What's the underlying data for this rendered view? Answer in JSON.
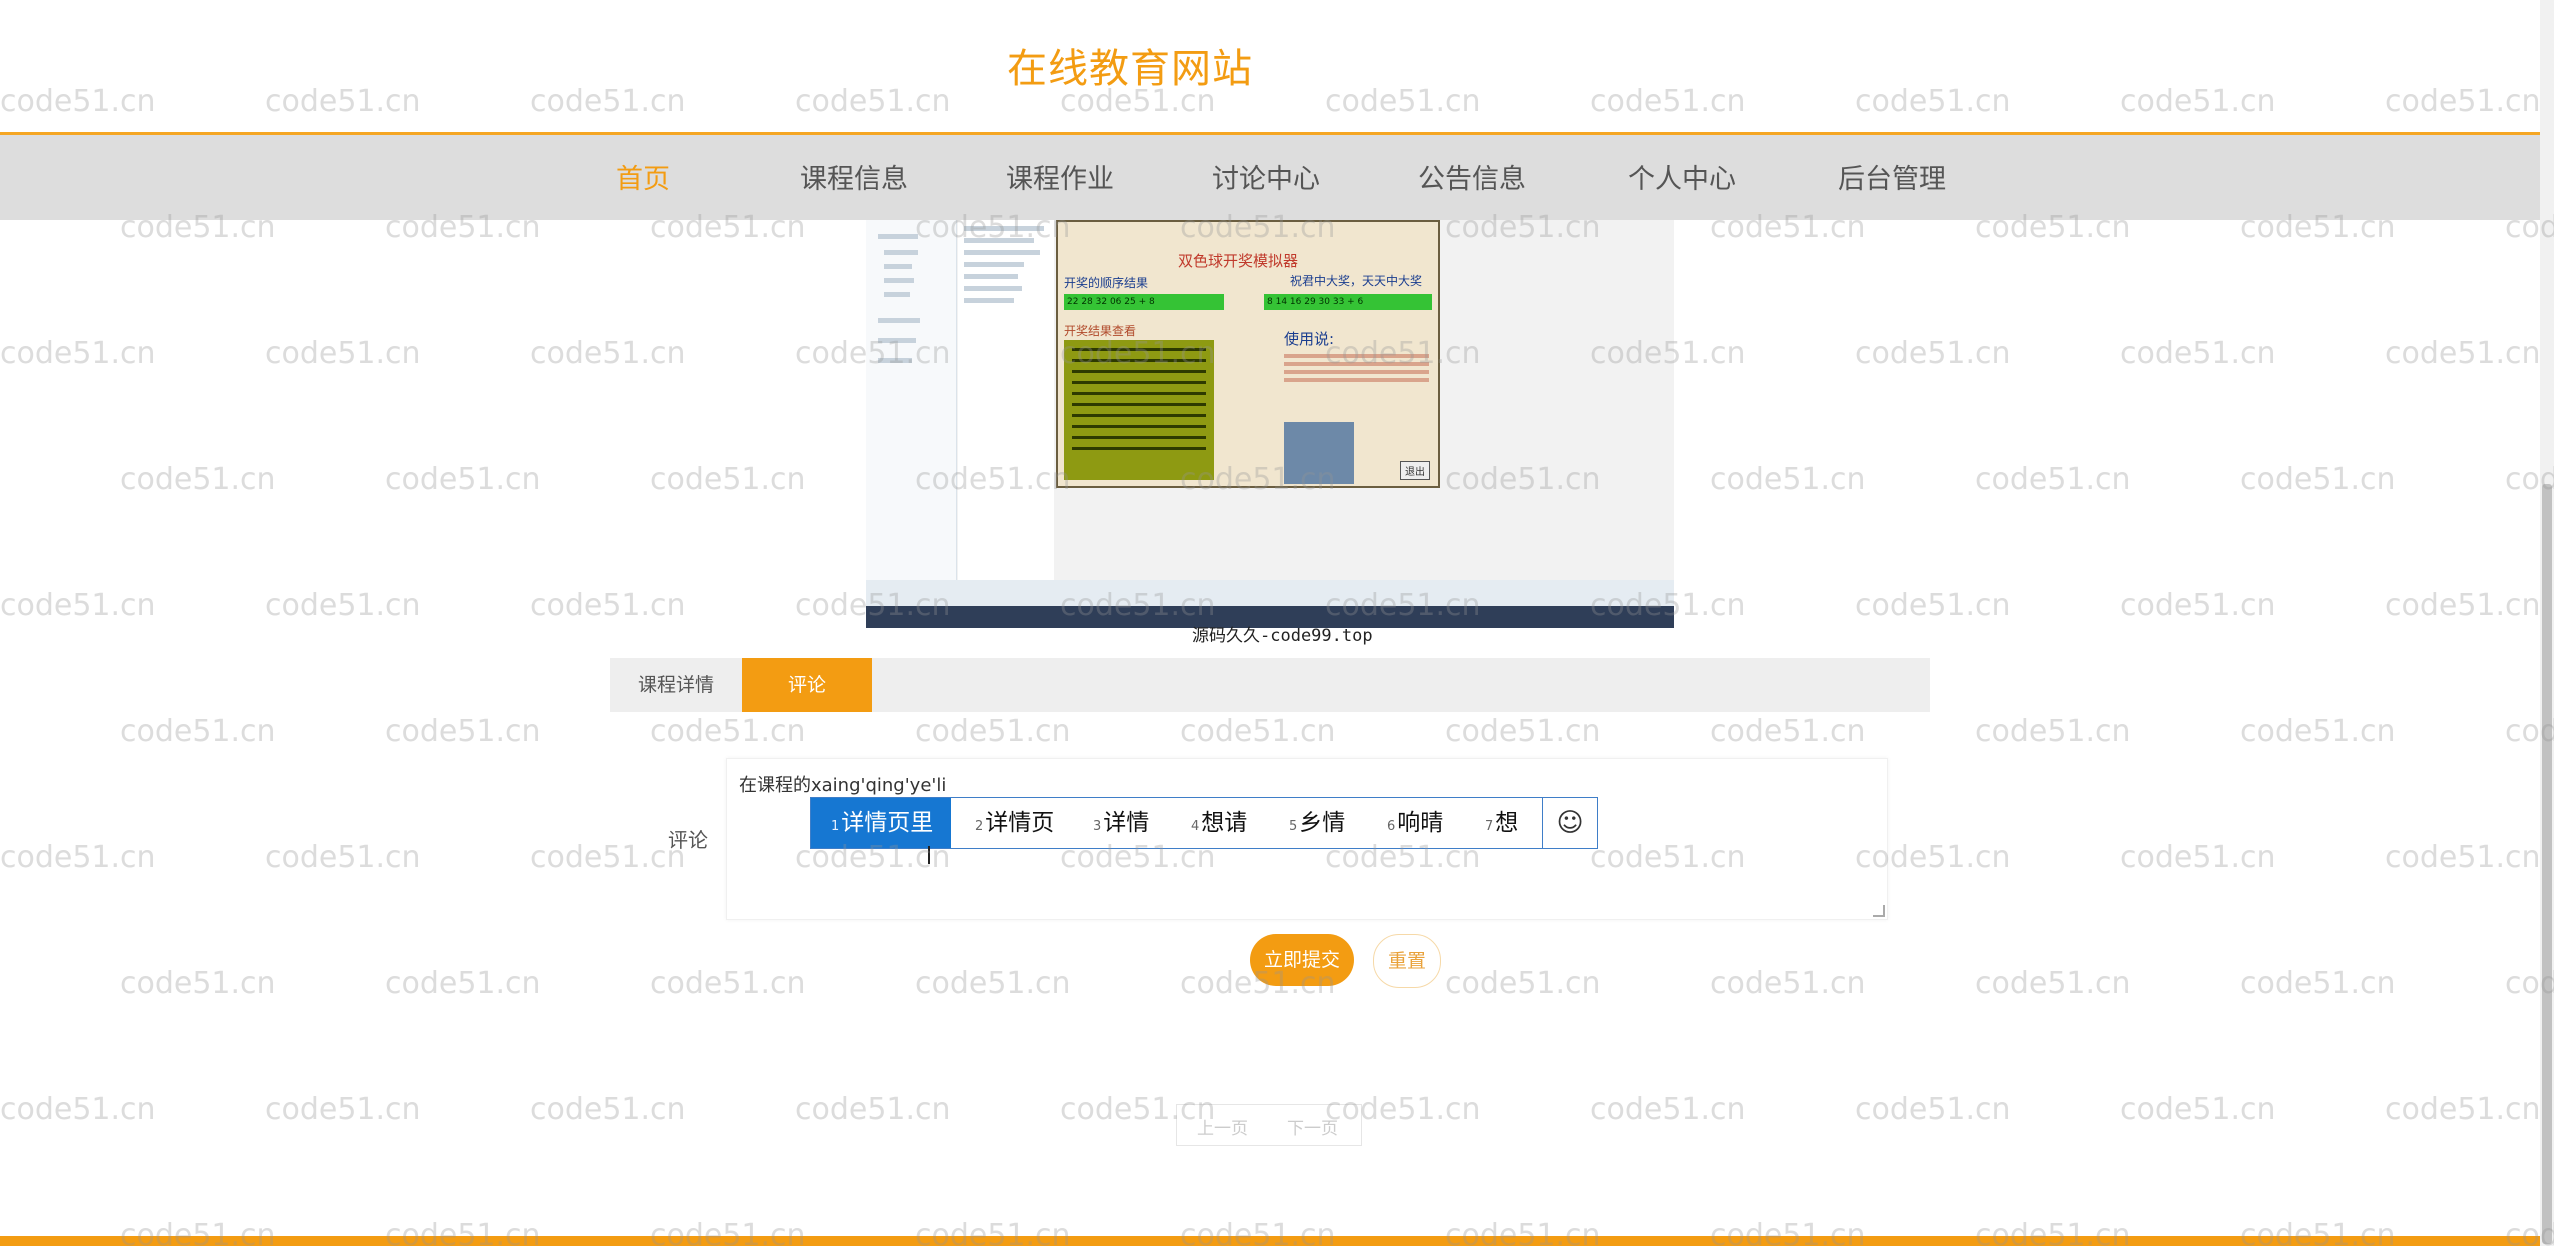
{
  "site": {
    "title": "在线教育网站"
  },
  "nav": {
    "items": [
      {
        "label": "首页",
        "active": true
      },
      {
        "label": "课程信息"
      },
      {
        "label": "课程作业"
      },
      {
        "label": "讨论中心"
      },
      {
        "label": "公告信息"
      },
      {
        "label": "个人中心"
      },
      {
        "label": "后台管理"
      }
    ]
  },
  "course_image": {
    "app_title": "双色球开奖模拟器",
    "panel_left_title": "开奖的顺序结果",
    "panel_right_title": "祝君中大奖，天天中大奖",
    "results_title": "开奖结果查看",
    "usage_title": "使用说:",
    "left_bar_numbers": "22 28 32 06 25 + 8",
    "right_bar_numbers": "8 14 16 29 30 33 + 6",
    "close_button": "退出"
  },
  "caption": "源码久久-code99.top",
  "tabs": [
    {
      "label": "课程详情",
      "active": false
    },
    {
      "label": "评论",
      "active": true
    }
  ],
  "comment": {
    "label": "评论",
    "typed_value": "在课程的xaing'qing'ye'li"
  },
  "ime": {
    "candidates": [
      {
        "num": "1",
        "text": "详情页里",
        "selected": true
      },
      {
        "num": "2",
        "text": "详情页"
      },
      {
        "num": "3",
        "text": "详情"
      },
      {
        "num": "4",
        "text": "想请"
      },
      {
        "num": "5",
        "text": "乡情"
      },
      {
        "num": "6",
        "text": "响晴"
      },
      {
        "num": "7",
        "text": "想"
      }
    ],
    "emoji": "☺"
  },
  "buttons": {
    "submit": "立即提交",
    "reset": "重置"
  },
  "pager": {
    "prev": "上一页",
    "next": "下一页"
  },
  "watermark": "code51.cn",
  "colors": {
    "accent": "#f39c12",
    "nav_bg": "#dddddd",
    "ime_selected": "#1677d2"
  }
}
